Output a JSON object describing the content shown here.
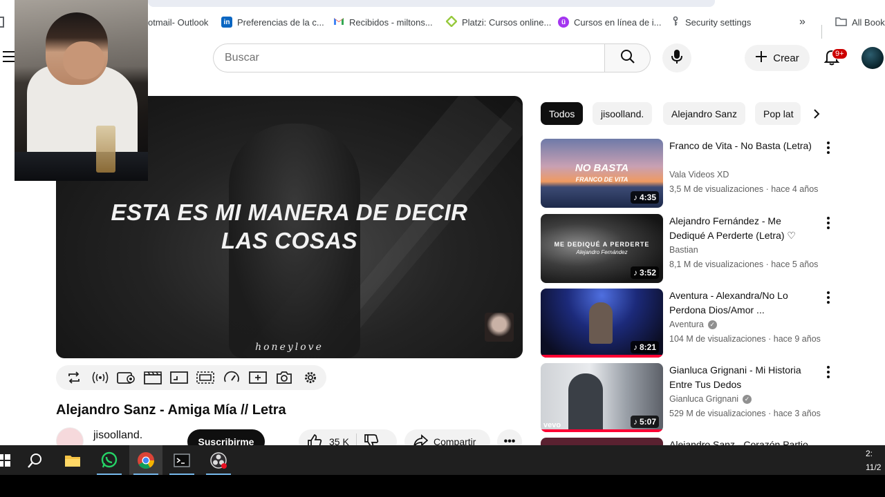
{
  "bookmarks": [
    {
      "label": "otmail- Outlook",
      "icon": "outlook-icon"
    },
    {
      "label": "Preferencias de la c...",
      "icon": "linkedin-icon"
    },
    {
      "label": "Recibidos - miltons...",
      "icon": "gmail-icon"
    },
    {
      "label": "Platzi: Cursos online...",
      "icon": "platzi-icon"
    },
    {
      "label": "Cursos en línea de i...",
      "icon": "udemy-icon"
    },
    {
      "label": "Security settings",
      "icon": "key-icon"
    },
    {
      "label": "All Bookm",
      "icon": "folder-icon"
    }
  ],
  "header": {
    "search_placeholder": "Buscar",
    "create_label": "Crear",
    "notifications_badge": "9+"
  },
  "player": {
    "lyric_line1": "ESTA ES MI MANERA DE DECIR",
    "lyric_line2": "LAS COSAS",
    "watermark": "honeylove"
  },
  "video": {
    "title": "Alejandro Sanz - Amiga Mía // Letra",
    "channel": "jisoolland.",
    "subscribe_label": "Suscribirme",
    "likes": "35 K",
    "share_label": "Compartir"
  },
  "chips": [
    "Todos",
    "jisoolland.",
    "Alejandro Sanz",
    "Pop lat"
  ],
  "related": [
    {
      "title": "Franco de Vita - No Basta (Letra)",
      "channel": "Vala Videos XD",
      "verified": false,
      "views": "3,5 M de visualizaciones",
      "age": "hace 4 años",
      "duration": "4:35",
      "thumb_line1": "NO BASTA",
      "thumb_line2": "FRANCO DE VITA",
      "progress": 0
    },
    {
      "title": "Alejandro Fernández - Me Dediqué A Perderte (Letra) ♡",
      "channel": "Bastian",
      "verified": false,
      "views": "8,1 M de visualizaciones",
      "age": "hace 5 años",
      "duration": "3:52",
      "thumb_line1": "ME DEDIQUÉ A PERDERTE",
      "thumb_line2": "Alejandro Fernández",
      "progress": 0
    },
    {
      "title": "Aventura - Alexandra/No Lo Perdona Dios/Amor ...",
      "channel": "Aventura",
      "verified": true,
      "views": "104 M de visualizaciones",
      "age": "hace 9 años",
      "duration": "8:21",
      "thumb_line1": "",
      "thumb_line2": "",
      "progress": 1
    },
    {
      "title": "Gianluca Grignani - Mi Historia Entre Tus Dedos",
      "channel": "Gianluca Grignani",
      "verified": true,
      "views": "529 M de visualizaciones",
      "age": "hace 3 años",
      "duration": "5:07",
      "thumb_line1": "",
      "thumb_line2": "vevo",
      "progress": 1
    },
    {
      "title": "Alejandro Sanz - Corazón Partio",
      "channel": "",
      "verified": false,
      "views": "",
      "age": "",
      "duration": "",
      "thumb_line1": "",
      "thumb_line2": "",
      "progress": 0
    }
  ],
  "taskbar": {
    "apps": [
      "windows-start-icon",
      "search-icon",
      "file-explorer-icon",
      "whatsapp-icon",
      "chrome-icon",
      "terminal-icon",
      "obs-icon"
    ],
    "clock_time": "2:",
    "clock_date": "11/2"
  },
  "colors": {
    "accent_red": "#ff0033",
    "chip_active": "#0f0f0f",
    "taskbar": "#1f1f1f"
  }
}
